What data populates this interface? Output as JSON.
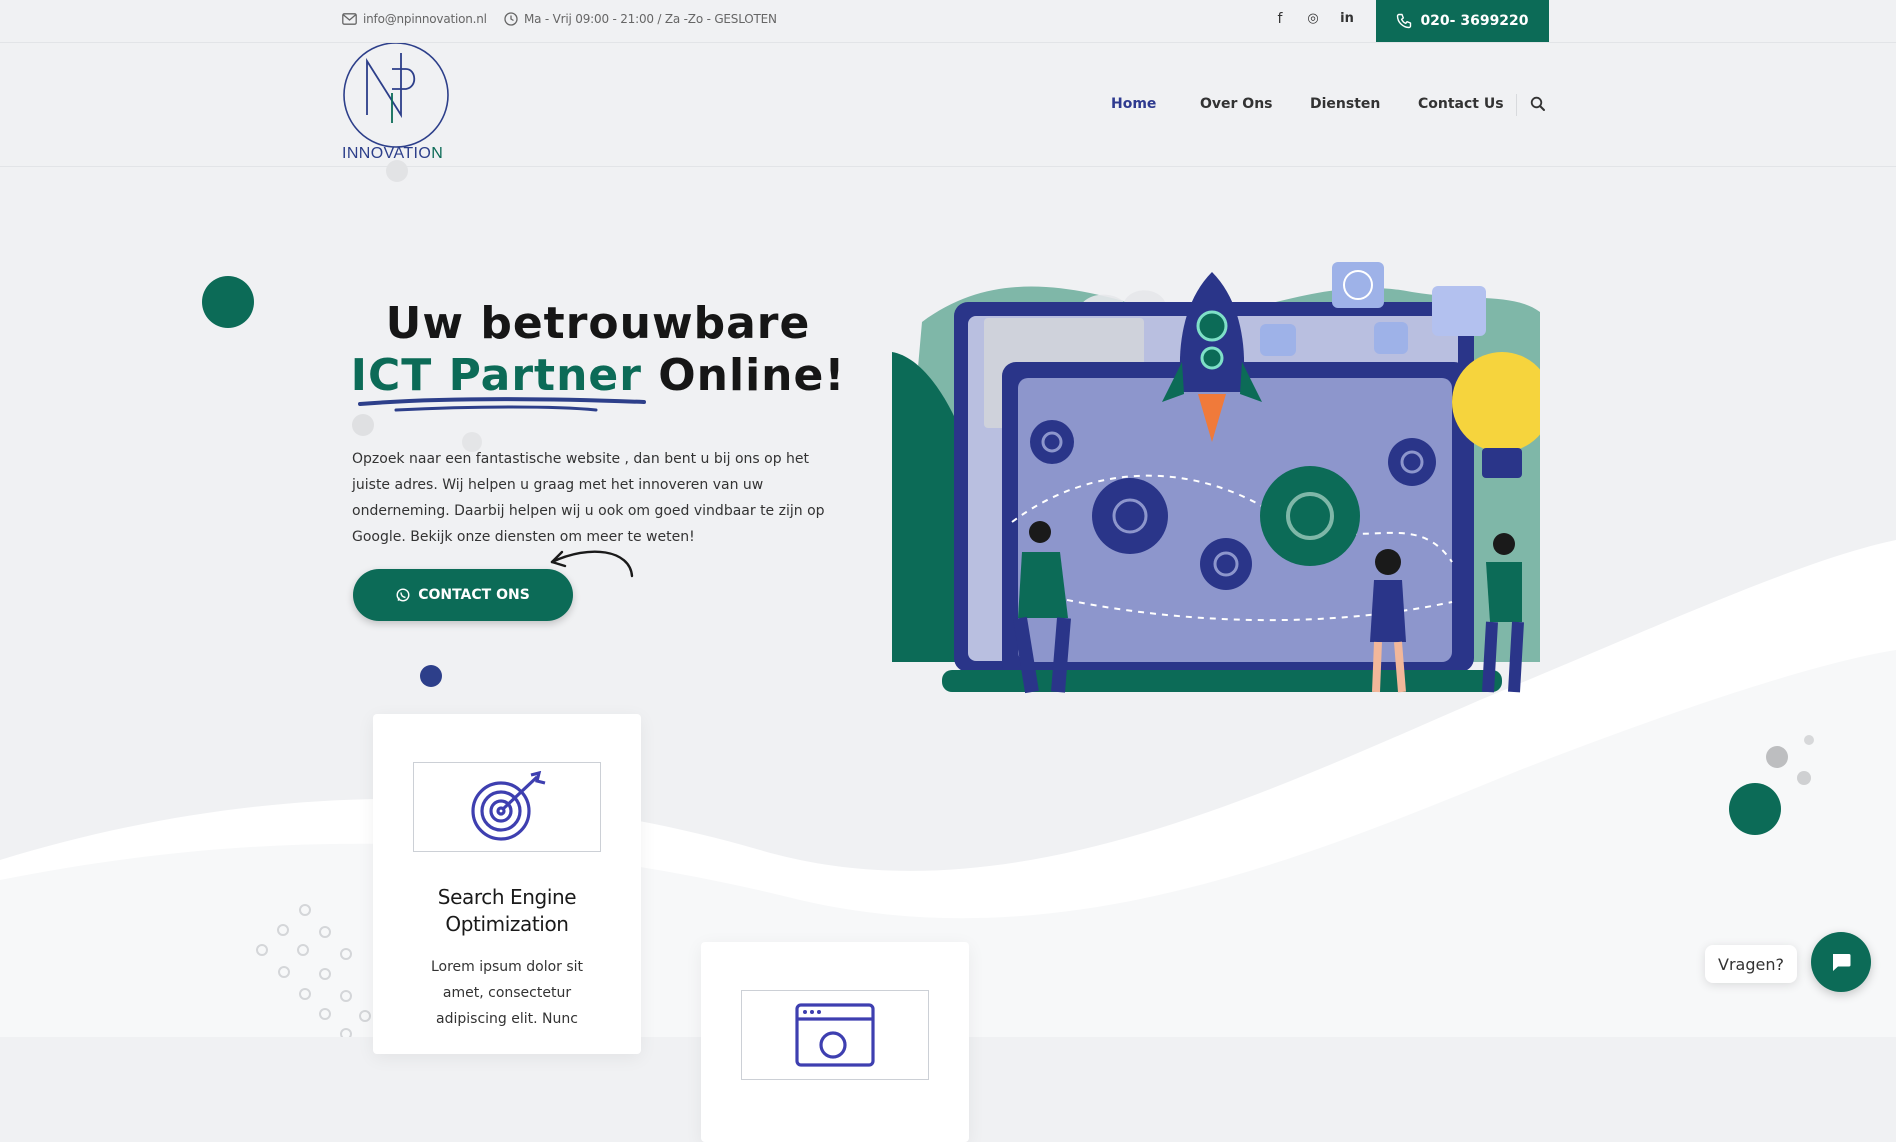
{
  "topbar": {
    "email": "info@npinnovation.nl",
    "hours": "Ma - Vrij 09:00 - 21:00 / Za -Zo - GESLOTEN",
    "social": [
      {
        "icon": "facebook-icon",
        "glyph": "f"
      },
      {
        "icon": "instagram-icon",
        "glyph": "◎"
      },
      {
        "icon": "linkedin-icon",
        "glyph": "in"
      }
    ],
    "phone": "020- 3699220"
  },
  "header": {
    "logo_text_main": "INNOVATIO",
    "logo_text_last": "N",
    "nav": [
      {
        "label": "Home",
        "active": true
      },
      {
        "label": "Over Ons",
        "active": false
      },
      {
        "label": "Diensten",
        "active": false
      },
      {
        "label": "Contact Us",
        "active": false
      }
    ]
  },
  "hero": {
    "title_line1": "Uw betrouwbare",
    "title_accent": "ICT Partner",
    "title_rest": " Online!",
    "text": "Opzoek naar een fantastische website , dan bent u bij ons op het juiste adres. Wij helpen u graag met het innoveren van uw onderneming. Daarbij helpen wij u ook om goed vindbaar te zijn op Google. Bekijk onze diensten om meer te weten!",
    "cta_label": "CONTACT ONS"
  },
  "features": [
    {
      "icon": "target-icon",
      "title": "Search Engine Optimization",
      "text": "Lorem ipsum dolor sit amet, consectetur adipiscing elit. Nunc"
    },
    {
      "icon": "browser-window-icon",
      "title": "",
      "text": ""
    }
  ],
  "chat": {
    "label": "Vragen?"
  },
  "colors": {
    "brand_green": "#0c6b57",
    "brand_navy": "#2e3a8f",
    "background": "#f0f1f3"
  }
}
